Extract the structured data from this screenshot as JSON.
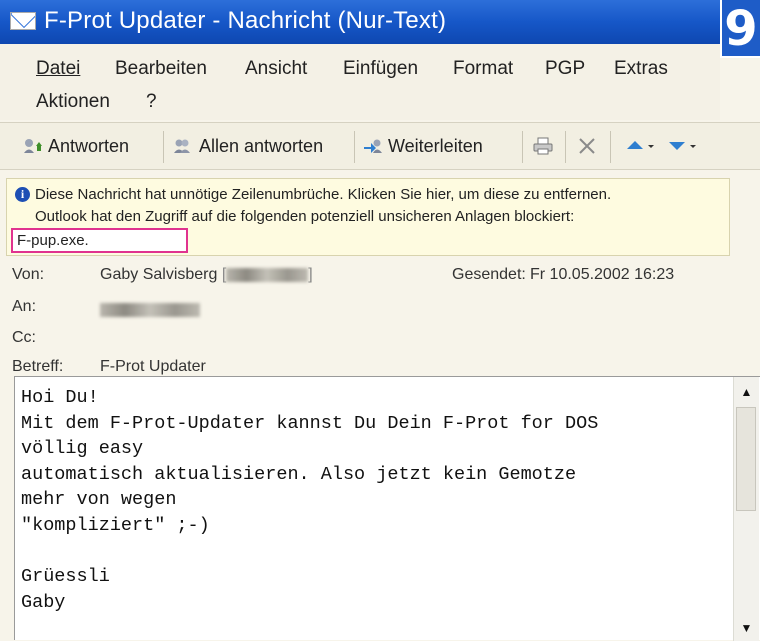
{
  "window": {
    "title": "F-Prot Updater - Nachricht (Nur-Text)",
    "badge": "9"
  },
  "menu": [
    {
      "label": "Datei"
    },
    {
      "label": "Bearbeiten"
    },
    {
      "label": "Ansicht"
    },
    {
      "label": "Einfügen"
    },
    {
      "label": "Format"
    },
    {
      "label": "PGP"
    },
    {
      "label": "Extras"
    },
    {
      "label": "Aktionen"
    },
    {
      "label": "?"
    }
  ],
  "toolbar": {
    "reply": "Antworten",
    "reply_all": "Allen antworten",
    "forward": "Weiterleiten",
    "print_icon": "printer-icon",
    "delete_icon": "delete-x-icon",
    "prev_icon": "up-arrow-icon",
    "next_icon": "down-arrow-icon"
  },
  "infobar": {
    "line1": "Diese Nachricht hat unnötige Zeilenumbrüche. Klicken Sie hier, um diese zu entfernen.",
    "line2": "Outlook hat den Zugriff auf die folgenden potenziell unsicheren Anlagen blockiert:",
    "attachment": "F-pup.exe.",
    "highlight_color": "#e0338f"
  },
  "header": {
    "from_label": "Von:",
    "from_value": "Gaby Salvisberg",
    "sent_label": "Gesendet:",
    "sent_value": "Fr 10.05.2002 16:23",
    "to_label": "An:",
    "cc_label": "Cc:",
    "subject_label": "Betreff:",
    "subject_value": "F-Prot Updater"
  },
  "message": {
    "lines": [
      "Hoi Du!",
      "Mit dem F-Prot-Updater kannst Du Dein F-Prot for DOS",
      "völlig easy",
      "automatisch aktualisieren. Also jetzt kein Gemotze",
      "mehr von wegen",
      "\"kompliziert\" ;-)",
      "",
      "Grüessli",
      "Gaby"
    ]
  }
}
